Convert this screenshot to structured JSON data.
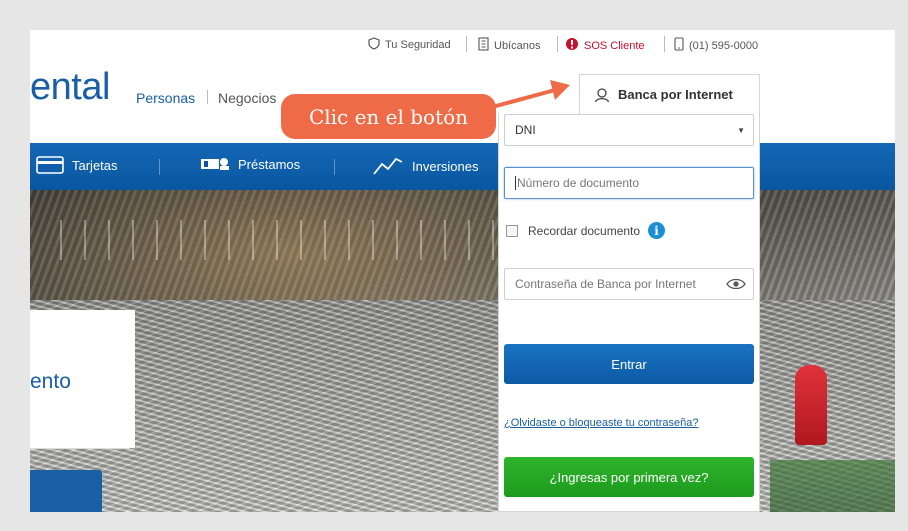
{
  "topbar": {
    "security": "Tu Seguridad",
    "locate": "Ubícanos",
    "sos": "SOS Cliente",
    "phone": "(01) 595-0000"
  },
  "header": {
    "logo_text": "ental",
    "segments": [
      "Personas",
      "Negocios"
    ]
  },
  "nav": {
    "items": [
      "Tarjetas",
      "Préstamos",
      "Inversiones"
    ]
  },
  "hero": {
    "title": "ento"
  },
  "login": {
    "tab_label": "Banca por Internet",
    "doc_type_value": "DNI",
    "doc_number_placeholder": "Número de documento",
    "remember_label": "Recordar documento",
    "password_placeholder": "Contraseña de Banca por Internet",
    "enter_label": "Entrar",
    "forgot_label": "¿Olvidaste o bloqueaste tu contraseña?",
    "first_time_label": "¿Ingresas por primera vez?"
  },
  "annotation": {
    "callout_text": "Clic en el botón",
    "color": "#ef6a47"
  },
  "colors": {
    "brand_blue": "#1a5ea6",
    "nav_blue": "#0a56a0",
    "green": "#1d9a1d",
    "sos_red": "#c8102e"
  }
}
